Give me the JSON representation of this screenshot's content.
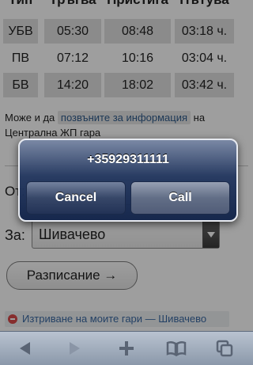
{
  "timetable": {
    "headers": [
      "Тип",
      "Тръгва",
      "Пристига",
      "Пътува"
    ],
    "rows": [
      {
        "type": "УБВ",
        "depart": "05:30",
        "arrive": "08:48",
        "duration": "03:18 ч."
      },
      {
        "type": "ПВ",
        "depart": "07:12",
        "arrive": "10:16",
        "duration": "03:04 ч."
      },
      {
        "type": "БВ",
        "depart": "14:20",
        "arrive": "18:02",
        "duration": "03:42 ч."
      }
    ]
  },
  "info": {
    "prefix": "Може и да",
    "link": "позвъните за информация",
    "suffix": "на",
    "line2": "Централна ЖП гара"
  },
  "form": {
    "from_label": "От:",
    "to_label": "За:",
    "to_value": "Шивачево",
    "schedule_button": "Разписание →"
  },
  "delete_link": "Изтриване на моите гари — Шивачево",
  "alert": {
    "title": "+35929311111",
    "cancel": "Cancel",
    "call": "Call"
  },
  "toolbar": {
    "icons": [
      "back-icon",
      "forward-icon",
      "add-icon",
      "bookmarks-icon",
      "pages-icon"
    ]
  }
}
